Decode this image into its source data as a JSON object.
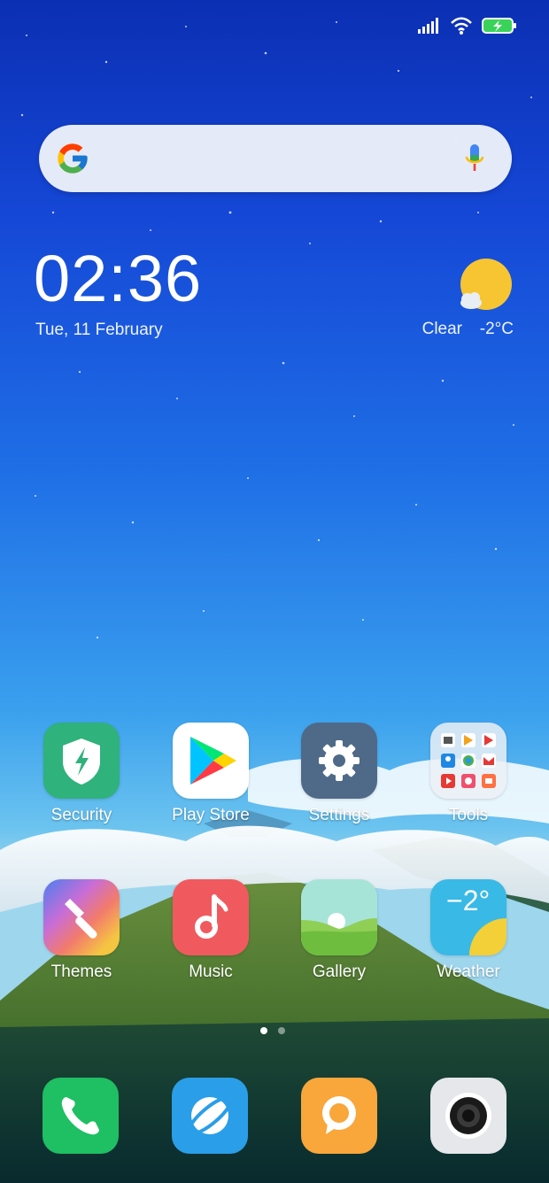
{
  "status_bar": {
    "icons": [
      "signal-icon",
      "wifi-icon",
      "battery-charging-icon"
    ]
  },
  "search": {
    "placeholder": ""
  },
  "clock": {
    "time": "02:36",
    "date": "Tue, 11 February"
  },
  "weather": {
    "condition": "Clear",
    "temperature": "-2°C"
  },
  "apps": {
    "security": "Security",
    "play_store": "Play Store",
    "settings": "Settings",
    "tools": "Tools",
    "themes": "Themes",
    "music": "Music",
    "gallery": "Gallery",
    "weather": "Weather",
    "weather_icon_temp": "−2°"
  },
  "pages": {
    "count": 2,
    "current": 1
  },
  "dock": [
    "phone",
    "browser",
    "messages",
    "camera"
  ],
  "colors": {
    "security": "#2fb27b",
    "music": "#f05a5f",
    "settings": "#4f6a88",
    "phone": "#1fbf63",
    "browser": "#2a9ee8",
    "messages": "#f9a63a"
  }
}
